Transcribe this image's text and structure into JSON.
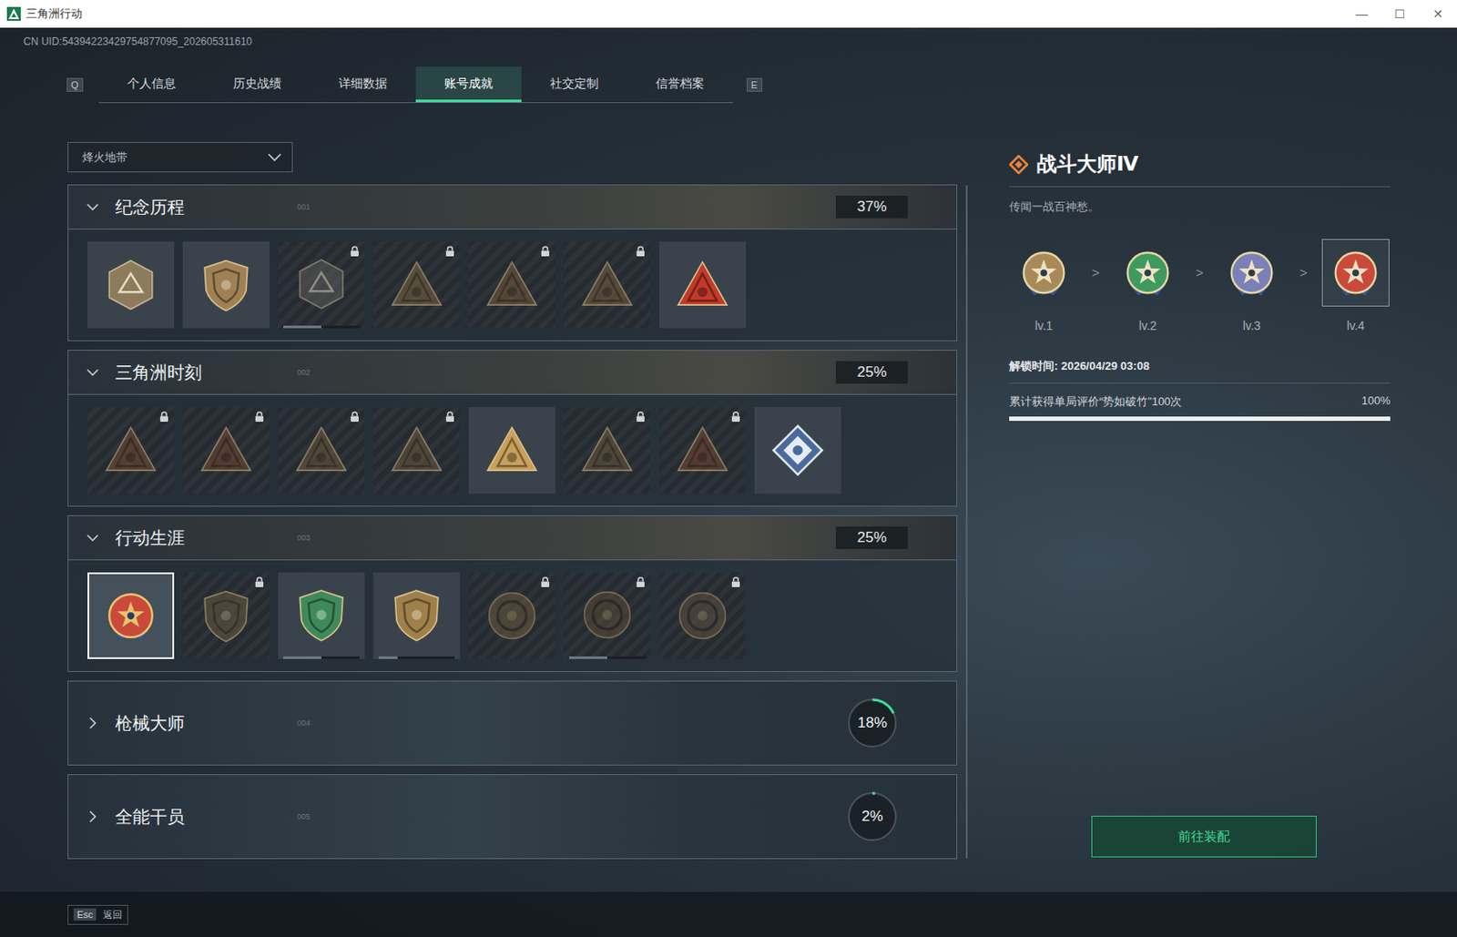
{
  "window": {
    "title": "三角洲行动",
    "controls": [
      "—",
      "☐",
      "✕"
    ]
  },
  "uid": "CN UID:54394223429754877095_202605311610",
  "tabs": {
    "prev_key": "Q",
    "next_key": "E",
    "items": [
      {
        "label": "个人信息",
        "selected": false
      },
      {
        "label": "历史战绩",
        "selected": false
      },
      {
        "label": "详细数据",
        "selected": false
      },
      {
        "label": "账号成就",
        "selected": true
      },
      {
        "label": "社交定制",
        "selected": false
      },
      {
        "label": "信誉档案",
        "selected": false
      }
    ]
  },
  "mode_select": {
    "value": "烽火地带"
  },
  "sections": [
    {
      "title": "纪念历程",
      "index": "001",
      "percent": "37%",
      "expanded": true,
      "badges": [
        {
          "kind": "hex",
          "color": "#8c7b5c",
          "locked": false,
          "selected": false
        },
        {
          "kind": "shield",
          "color": "#a08055",
          "locked": false,
          "selected": false
        },
        {
          "kind": "hex",
          "color": "#5c5c5c",
          "locked": true,
          "selected": false,
          "level": 0.5
        },
        {
          "kind": "triangle",
          "color": "#7d6540",
          "locked": true,
          "selected": false
        },
        {
          "kind": "triangle",
          "color": "#7a5a3c",
          "locked": true,
          "selected": false
        },
        {
          "kind": "triangle",
          "color": "#7a6040",
          "locked": true,
          "selected": false
        },
        {
          "kind": "triangle",
          "color": "#c23a2a",
          "locked": false,
          "selected": false
        }
      ]
    },
    {
      "title": "三角洲时刻",
      "index": "002",
      "percent": "25%",
      "expanded": true,
      "badges": [
        {
          "kind": "triangle",
          "color": "#7a4a30",
          "locked": true,
          "selected": false
        },
        {
          "kind": "triangle",
          "color": "#7a4630",
          "locked": true,
          "selected": false
        },
        {
          "kind": "triangle",
          "color": "#6e5a3c",
          "locked": true,
          "selected": false
        },
        {
          "kind": "triangle",
          "color": "#6e5a3c",
          "locked": true,
          "selected": false
        },
        {
          "kind": "triangle",
          "color": "#c8a05a",
          "locked": false,
          "selected": false
        },
        {
          "kind": "triangle",
          "color": "#6e5a3c",
          "locked": true,
          "selected": false
        },
        {
          "kind": "triangle",
          "color": "#7a4630",
          "locked": true,
          "selected": false
        },
        {
          "kind": "diamond",
          "color": "#4b6a9c",
          "locked": false,
          "selected": false
        }
      ]
    },
    {
      "title": "行动生涯",
      "index": "003",
      "percent": "25%",
      "expanded": true,
      "badges": [
        {
          "kind": "medal",
          "color": "#c94a3a",
          "locked": false,
          "selected": true
        },
        {
          "kind": "shield",
          "color": "#6a5a40",
          "locked": true,
          "selected": false
        },
        {
          "kind": "shield",
          "color": "#3f8a5c",
          "locked": false,
          "selected": false,
          "level": 0.5
        },
        {
          "kind": "shield",
          "color": "#a0804a",
          "locked": false,
          "selected": false,
          "level": 0.25
        },
        {
          "kind": "coin",
          "color": "#6a5a40",
          "locked": true,
          "selected": false
        },
        {
          "kind": "coin",
          "color": "#5a4a38",
          "locked": true,
          "selected": false,
          "level": 0.5
        },
        {
          "kind": "coin",
          "color": "#5e5040",
          "locked": true,
          "selected": false
        }
      ]
    },
    {
      "title": "枪械大师",
      "index": "004",
      "percent": "18%",
      "expanded": false,
      "level": 0.18,
      "badges": []
    },
    {
      "title": "全能干员",
      "index": "005",
      "percent": "2%",
      "expanded": false,
      "level": 0.02,
      "badges": []
    }
  ],
  "detail": {
    "title": "战斗大师Ⅳ",
    "description": "传闻一战百神愁。",
    "separator": ">",
    "levels": [
      {
        "label": "lv.1",
        "selected": false,
        "color": "#a88a5a"
      },
      {
        "label": "lv.2",
        "selected": false,
        "color": "#3f9a60"
      },
      {
        "label": "lv.3",
        "selected": false,
        "color": "#7a80b8"
      },
      {
        "label": "lv.4",
        "selected": true,
        "color": "#c94a3a"
      }
    ],
    "unlock_time": "解锁时间: 2026/04/29 03:08",
    "requirement": {
      "text": "累计获得单局评价“势如破竹”100次",
      "reading": "100%",
      "level": 1
    },
    "button": "前往装配"
  },
  "footer": {
    "key": "Esc",
    "label": "返回"
  }
}
